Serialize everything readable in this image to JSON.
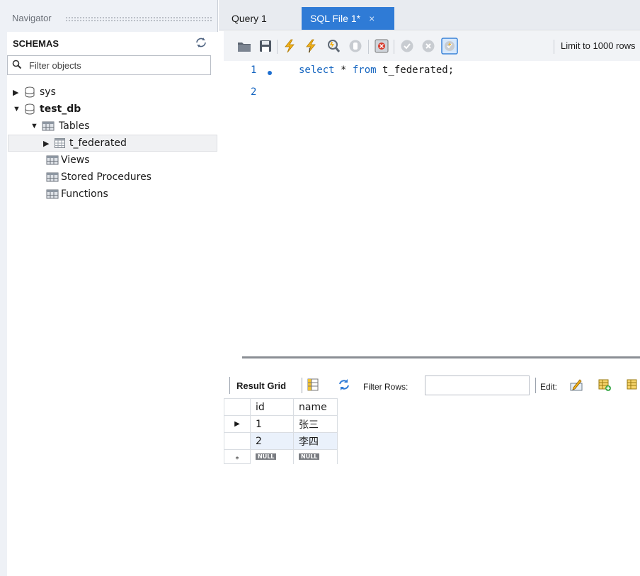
{
  "navigator": {
    "title": "Navigator",
    "schemas_label": "SCHEMAS",
    "filter_placeholder": "Filter objects",
    "tree": {
      "sys": "sys",
      "test_db": "test_db",
      "tables": "Tables",
      "t_federated": "t_federated",
      "views": "Views",
      "stored_procedures": "Stored Procedures",
      "functions": "Functions"
    }
  },
  "tabs": [
    {
      "label": "Query 1"
    },
    {
      "label": "SQL File 1*",
      "close": "×"
    }
  ],
  "toolbar": {
    "limit_label": "Limit to 1000 rows",
    "icons": [
      "open-file-icon",
      "save-icon",
      "execute-icon",
      "execute-current-icon",
      "explain-icon",
      "stop-icon",
      "toggle-error-icon",
      "commit-icon",
      "rollback-icon",
      "autocommit-icon"
    ]
  },
  "editor": {
    "lines": [
      {
        "number": "1",
        "has_dot": true,
        "tokens": [
          "select",
          " * ",
          "from",
          " t_federated;"
        ]
      },
      {
        "number": "2",
        "has_dot": false,
        "tokens": []
      }
    ]
  },
  "results": {
    "result_grid_label": "Result Grid",
    "filter_rows_label": "Filter Rows:",
    "edit_label": "Edit:",
    "columns": [
      "id",
      "name"
    ],
    "rows": [
      {
        "id": "1",
        "name": "张三"
      },
      {
        "id": "2",
        "name": "李四"
      }
    ],
    "null_label": "NULL",
    "new_row_marker": "*",
    "current_row_marker": "▶"
  },
  "colors": {
    "accent": "#2f7bd6",
    "keyword": "#1565c0"
  }
}
